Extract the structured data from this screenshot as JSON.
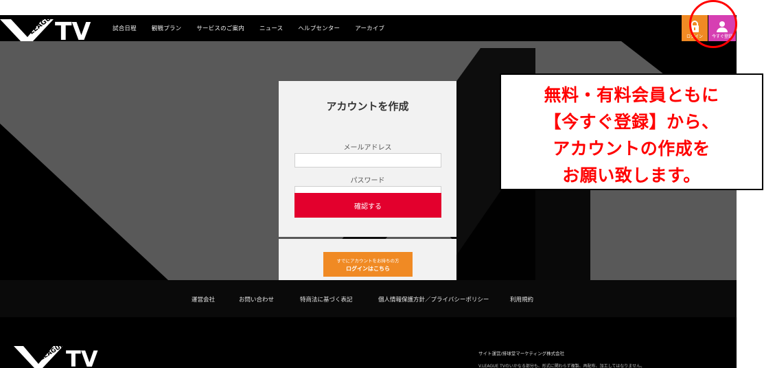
{
  "header": {
    "logo_text": "TV",
    "logo_badge": "LEAGUE",
    "nav": [
      "試合日程",
      "観戦プラン",
      "サービスのご案内",
      "ニュース",
      "ヘルプセンター",
      "アーカイブ"
    ],
    "login_label": "ログイン",
    "register_label": "今すぐ登録",
    "login_color": "#f08a24",
    "register_color": "#d63fb2"
  },
  "form": {
    "title": "アカウントを作成",
    "email_label": "メールアドレス",
    "email_value": "",
    "password_label": "パスワード",
    "password_value": "",
    "confirm_label": "確認する",
    "confirm_color": "#e3002d",
    "existing_line1": "すでにアカウントをお持ちの方",
    "existing_line2": "ログインはこちら"
  },
  "footer": {
    "links": [
      "運営会社",
      "お問い合わせ",
      "特商法に基づく表記",
      "個人情報保護方針／プライバシーポリシー",
      "利用規約"
    ],
    "logo_text": "TV",
    "logo_badge": "LEAGUE",
    "company": "サイト運営/排球堂マーケティング株式会社",
    "copyright": "V.LEAGUE TVのいかなる部分も、形式に関わらず複製、再配布、加工してはなりません。"
  },
  "callout": {
    "lines": [
      "無料・有料会員ともに",
      "【今すぐ登録】から、",
      "アカウントの作成を",
      "お願い致します。"
    ],
    "text_color": "#ff0000"
  },
  "icons": {
    "login": "lock-icon",
    "register": "user-icon"
  }
}
